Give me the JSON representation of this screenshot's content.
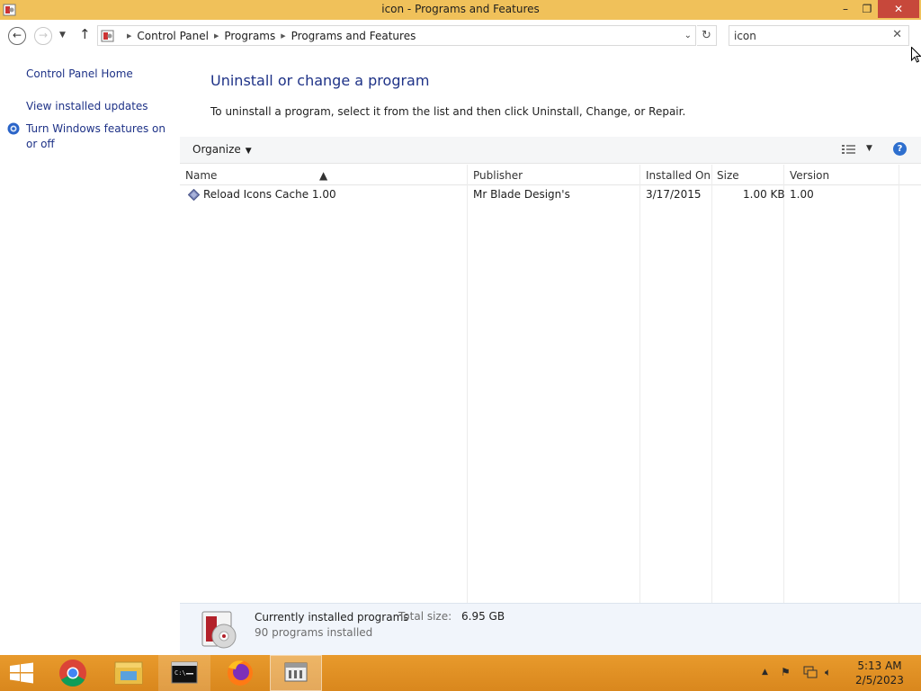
{
  "window": {
    "title": "icon - Programs and Features",
    "minimize": "–",
    "maximize": "❐",
    "close": "✕"
  },
  "nav": {
    "breadcrumbs": [
      "Control Panel",
      "Programs",
      "Programs and Features"
    ],
    "search_value": "icon",
    "search_clear": "✕"
  },
  "sidebar": {
    "home": "Control Panel Home",
    "updates": "View installed updates",
    "features": "Turn Windows features on or off"
  },
  "main": {
    "heading": "Uninstall or change a program",
    "instructions": "To uninstall a program, select it from the list and then click Uninstall, Change, or Repair.",
    "organize": "Organize",
    "help": "?"
  },
  "table": {
    "columns": [
      "Name",
      "Publisher",
      "Installed On",
      "Size",
      "Version"
    ],
    "rows": [
      {
        "name": "Reload Icons Cache 1.00",
        "publisher": "Mr Blade Design's",
        "installed_on": "3/17/2015",
        "size": "1.00 KB",
        "version": "1.00"
      }
    ]
  },
  "details": {
    "label": "Currently installed programs",
    "total_size_label": "Total size:",
    "total_size": "6.95 GB",
    "count": "90 programs installed"
  },
  "taskbar": {
    "apps": [
      "chrome",
      "file-explorer",
      "command-prompt",
      "firefox",
      "control-panel"
    ],
    "time": "5:13 AM",
    "date": "2/5/2023"
  },
  "colors": {
    "titlebar": "#f0c15a",
    "taskbar": "#e89a2c",
    "link": "#1e3287"
  }
}
